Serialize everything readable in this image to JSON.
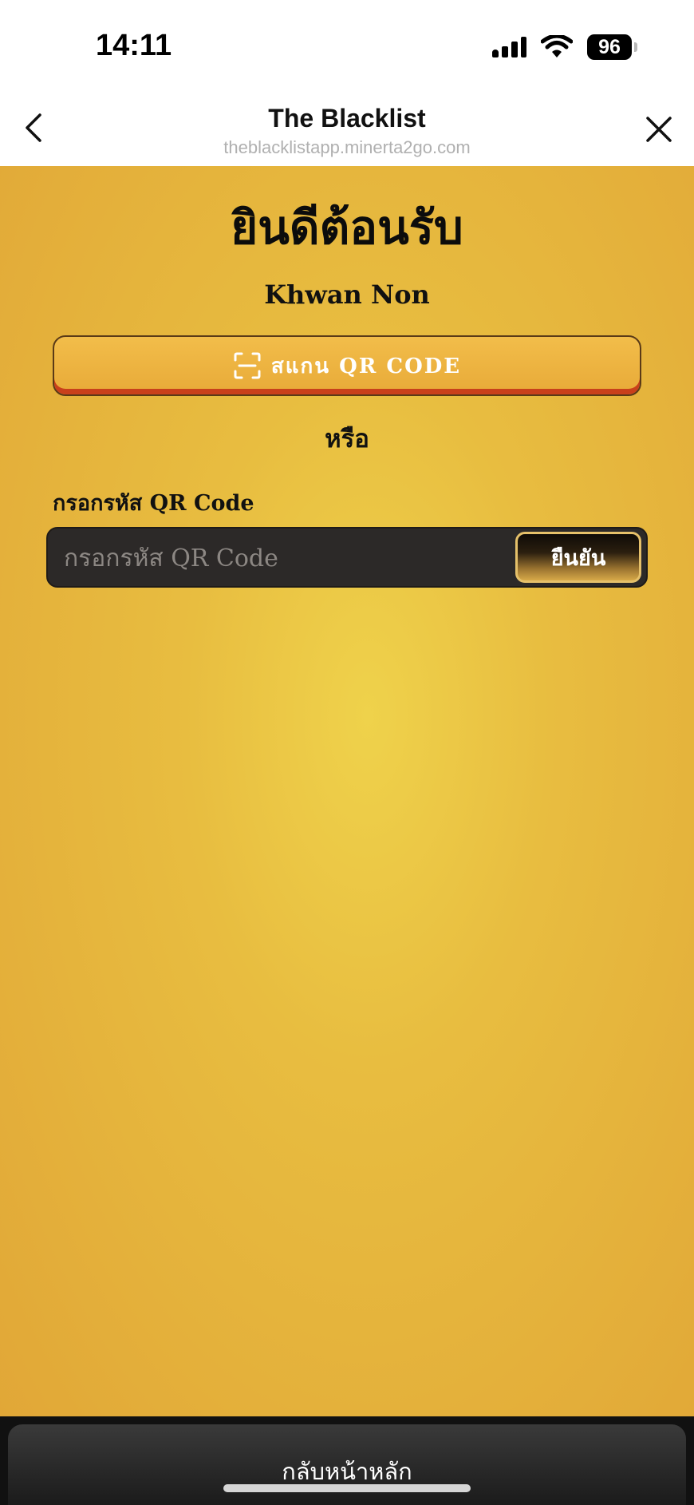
{
  "status_bar": {
    "time": "14:11",
    "battery": "96"
  },
  "nav": {
    "title": "The Blacklist",
    "url": "theblacklistapp.minerta2go.com",
    "back_icon": "chevron-left-icon",
    "close_icon": "close-icon"
  },
  "main": {
    "welcome": "ยินดีต้อนรับ",
    "user_name": "Khwan Non",
    "scan_button": {
      "icon": "qr-scan-icon",
      "label": "สแกน QR CODE"
    },
    "or_text": "หรือ",
    "code_label": "กรอกรหัส QR Code",
    "code_input": {
      "value": "",
      "placeholder": "กรอกรหัส QR Code"
    },
    "confirm_label": "ยืนยัน"
  },
  "bottom": {
    "home_label": "กลับหน้าหลัก"
  },
  "colors": {
    "background": "#e8bd40",
    "scan_button": "#eeb645",
    "input_bg": "#2c2928",
    "bottom_bar": "#1b1b1b"
  }
}
